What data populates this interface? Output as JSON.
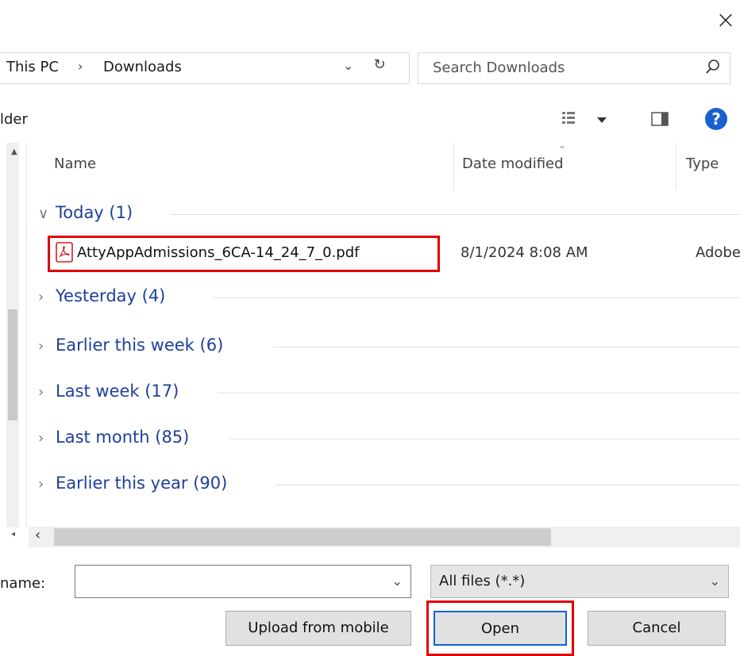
{
  "window": {
    "close_glyph": "×"
  },
  "address_bar": {
    "crumbs": [
      "This PC",
      "Downloads"
    ],
    "separator": "›",
    "dropdown_glyph": "⌄",
    "refresh_glyph": "↻"
  },
  "search": {
    "placeholder": "Search Downloads"
  },
  "toolbar": {
    "partial_label": "lder"
  },
  "columns": {
    "name": "Name",
    "date": "Date modified",
    "type": "Type"
  },
  "groups": [
    {
      "label": "Today (1)",
      "expanded": true
    },
    {
      "label": "Yesterday (4)",
      "expanded": false
    },
    {
      "label": "Earlier this week (6)",
      "expanded": false
    },
    {
      "label": "Last week (17)",
      "expanded": false
    },
    {
      "label": "Last month (85)",
      "expanded": false
    },
    {
      "label": "Earlier this year (90)",
      "expanded": false
    }
  ],
  "files": [
    {
      "name": "AttyAppAdmissions_6CA-14_24_7_0.pdf",
      "date": "8/1/2024 8:08 AM",
      "type": "Adobe",
      "icon": "pdf-icon"
    }
  ],
  "bottom": {
    "name_label": "name:",
    "name_value": "",
    "filter_value": "All files (*.*)",
    "upload_label": "Upload from mobile",
    "open_label": "Open",
    "cancel_label": "Cancel"
  },
  "colors": {
    "group_text": "#1e3f9a",
    "highlight": "#e00000",
    "focus": "#0a63d8",
    "help": "#1a5fd0"
  }
}
